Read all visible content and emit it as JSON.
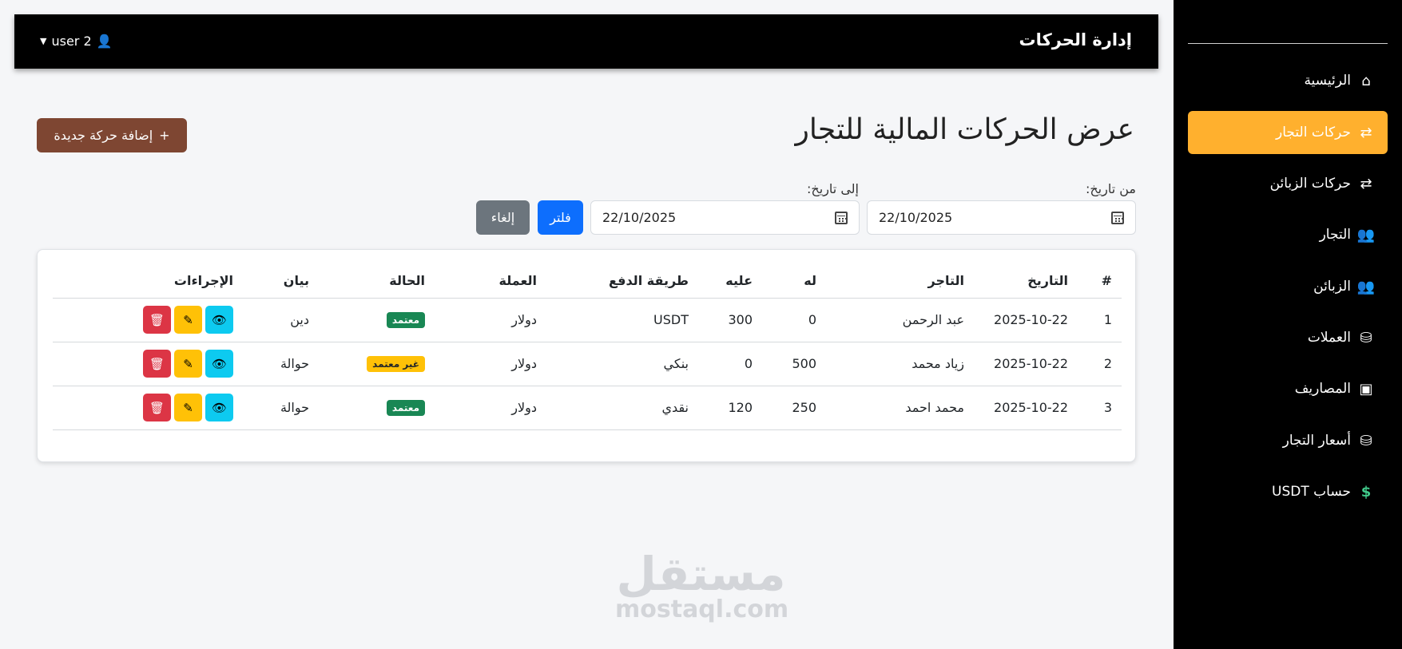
{
  "topbar": {
    "title": "إدارة الحركات",
    "user": "user 2"
  },
  "sidebar": {
    "items": [
      {
        "label": "الرئيسية",
        "icon": "home-icon",
        "glyph": "⌂",
        "active": false
      },
      {
        "label": "حركات التجار",
        "icon": "exchange-icon",
        "glyph": "⇄",
        "active": true
      },
      {
        "label": "حركات الزبائن",
        "icon": "exchange-icon",
        "glyph": "⇄",
        "active": false
      },
      {
        "label": "التجار",
        "icon": "users-icon",
        "glyph": "👥",
        "active": false
      },
      {
        "label": "الزبائن",
        "icon": "user-group-icon",
        "glyph": "👥",
        "active": false
      },
      {
        "label": "العملات",
        "icon": "coins-icon",
        "glyph": "⛁",
        "active": false
      },
      {
        "label": "المصاريف",
        "icon": "wallet-icon",
        "glyph": "▣",
        "active": false
      },
      {
        "label": "أسعار التجار",
        "icon": "coins-icon",
        "glyph": "⛁",
        "active": false
      },
      {
        "label": "حساب USDT",
        "icon": "dollar-icon",
        "glyph": "$",
        "active": false
      }
    ]
  },
  "page": {
    "title": "عرض الحركات المالية للتجار",
    "add_button": "إضافة حركة جديدة"
  },
  "filters": {
    "from_label": "من تاريخ:",
    "to_label": "إلى تاريخ:",
    "from_value": "22/10/2025",
    "to_value": "22/10/2025",
    "filter_button": "فلتر",
    "cancel_button": "إلغاء"
  },
  "table": {
    "headers": [
      "#",
      "التاريخ",
      "التاجر",
      "له",
      "عليه",
      "طريقة الدفع",
      "العملة",
      "الحالة",
      "بيان",
      "الإجراءات"
    ],
    "rows": [
      {
        "num": "1",
        "date": "2025-10-22",
        "merchant": "عبد الرحمن",
        "credit": "0",
        "debit": "300",
        "payment": "USDT",
        "currency": "دولار",
        "status": "معتمد",
        "status_type": "approved",
        "note": "دين"
      },
      {
        "num": "2",
        "date": "2025-10-22",
        "merchant": "زياد محمد",
        "credit": "500",
        "debit": "0",
        "payment": "بنكي",
        "currency": "دولار",
        "status": "غير معتمد",
        "status_type": "pending",
        "note": "حوالة"
      },
      {
        "num": "3",
        "date": "2025-10-22",
        "merchant": "محمد احمد",
        "credit": "250",
        "debit": "120",
        "payment": "نقدي",
        "currency": "دولار",
        "status": "معتمد",
        "status_type": "approved",
        "note": "حوالة"
      }
    ]
  },
  "watermark": {
    "arabic": "مستقل",
    "latin": "mostaql.com"
  },
  "colors": {
    "accent": "#ffb02e",
    "brand_button": "#7e4632",
    "primary": "#0d6efd",
    "secondary": "#6c757d"
  }
}
